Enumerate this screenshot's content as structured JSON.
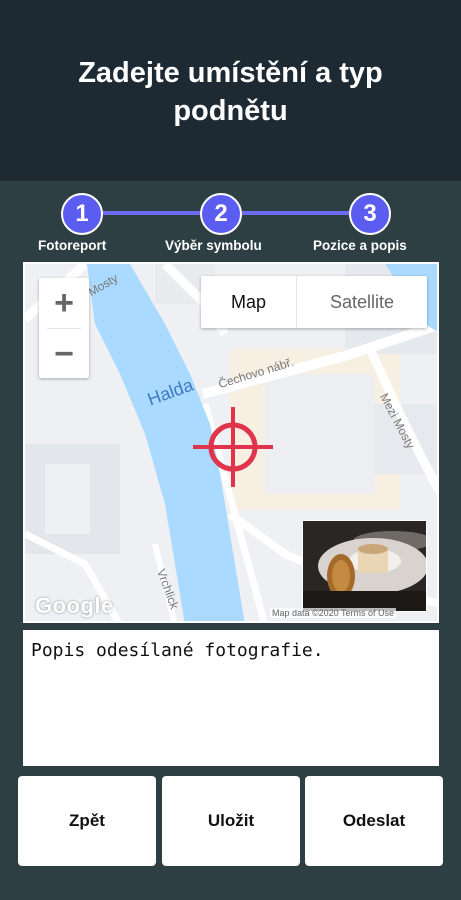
{
  "header": {
    "title": "Zadejte umístění a typ podnětu"
  },
  "stepper": {
    "steps": [
      {
        "number": "1",
        "label": "Fotoreport"
      },
      {
        "number": "2",
        "label": "Výběr symbolu"
      },
      {
        "number": "3",
        "label": "Pozice a popis"
      }
    ],
    "accent_color": "#5b5cf0"
  },
  "map": {
    "zoom_in": "+",
    "zoom_out": "−",
    "type_map": "Map",
    "type_satellite": "Satellite",
    "streets": {
      "mosty_top": "Mosty",
      "river": "Halda",
      "cechovo": "Čechovo nábř.",
      "mezi_mosty": "Mezi Mosty",
      "vrchlick": "Vrchlick"
    },
    "logo": "Google",
    "attribution": "Map data ©2020   Terms of Use",
    "crosshair_icon": "crosshair-icon",
    "crosshair_color": "#e0344d"
  },
  "description": {
    "value": "Popis odesílané fotografie."
  },
  "buttons": {
    "back": "Zpět",
    "save": "Uložit",
    "send": "Odeslat"
  }
}
